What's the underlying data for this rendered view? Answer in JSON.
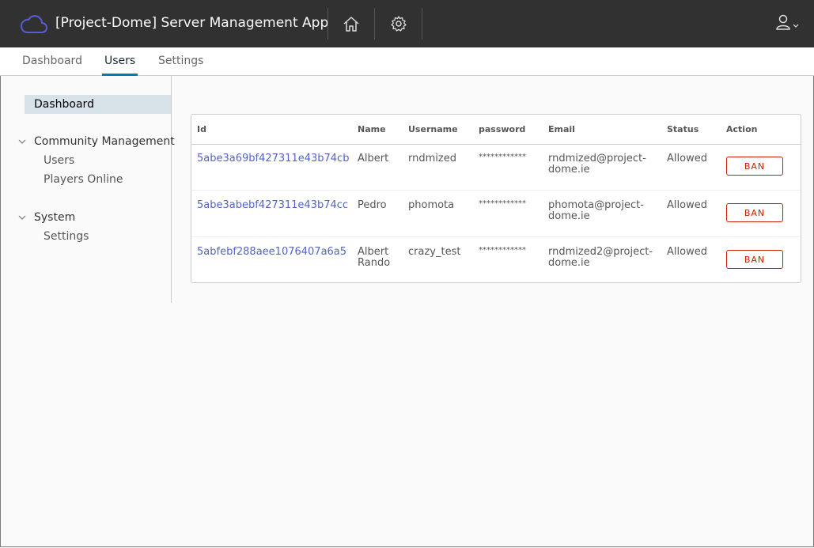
{
  "header": {
    "title": "[Project-Dome] Server Management App",
    "icons": [
      "cloud-logo-icon",
      "home-icon",
      "gear-icon",
      "user-icon",
      "chevron-down-icon"
    ]
  },
  "subnav": {
    "tabs": [
      {
        "label": "Dashboard",
        "active": false
      },
      {
        "label": "Users",
        "active": true
      },
      {
        "label": "Settings",
        "active": false
      }
    ]
  },
  "sidebar": {
    "active_item": "Dashboard",
    "groups": [
      {
        "label": "Community Management",
        "items": [
          "Users",
          "Players Online"
        ]
      },
      {
        "label": "System",
        "items": [
          "Settings"
        ]
      }
    ]
  },
  "table": {
    "columns": [
      "Id",
      "Name",
      "Username",
      "password",
      "Email",
      "Status",
      "Action"
    ],
    "rows": [
      {
        "id": "5abe3a69bf427311e43b74cb",
        "name": "Albert",
        "name2": "",
        "username": "rndmized",
        "password": "************",
        "email1": "rndmized@project-",
        "email2": "dome.ie",
        "status": "Allowed",
        "action": "BAN"
      },
      {
        "id": "5abe3abebf427311e43b74cc",
        "name": "Pedro",
        "name2": "",
        "username": "phomota",
        "password": "************",
        "email1": "phomota@project-",
        "email2": "dome.ie",
        "status": "Allowed",
        "action": "BAN"
      },
      {
        "id": "5abfebf288aee1076407a6a5",
        "name": "Albert",
        "name2": "Rando",
        "username": "crazy_test",
        "password": "************",
        "email1": "rndmized2@project-",
        "email2": "dome.ie",
        "status": "Allowed",
        "action": "BAN"
      }
    ]
  },
  "colors": {
    "header_bg": "#313131",
    "accent": "#0079b8",
    "link": "#5264c6",
    "danger": "#c92100",
    "logo": "#5b5bd6"
  }
}
